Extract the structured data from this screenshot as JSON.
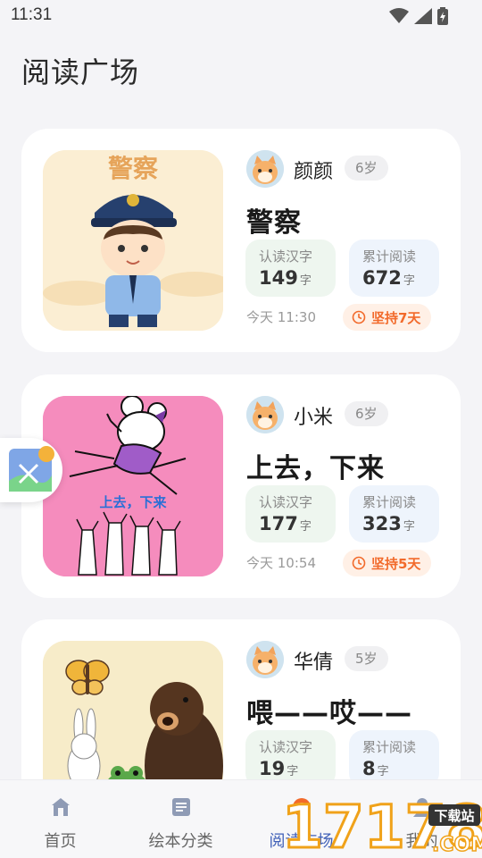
{
  "status_bar": {
    "time": "11:31"
  },
  "page_title": "阅读广场",
  "cards": [
    {
      "user_name": "颜颜",
      "age": "6岁",
      "book_title": "警察",
      "stat_words_label": "认读汉字",
      "stat_words_value": "149",
      "stat_words_unit": "字",
      "stat_read_label": "累计阅读",
      "stat_read_value": "672",
      "stat_read_unit": "字",
      "time": "今天 11:30",
      "streak": "坚持7天",
      "cover_text": "警察"
    },
    {
      "user_name": "小米",
      "age": "6岁",
      "book_title": "上去，下来",
      "stat_words_label": "认读汉字",
      "stat_words_value": "177",
      "stat_words_unit": "字",
      "stat_read_label": "累计阅读",
      "stat_read_value": "323",
      "stat_read_unit": "字",
      "time": "今天 10:54",
      "streak": "坚持5天",
      "cover_text": "上去，下来"
    },
    {
      "user_name": "华倩",
      "age": "5岁",
      "book_title": "喂——哎——",
      "stat_words_label": "认读汉字",
      "stat_words_value": "19",
      "stat_words_unit": "字",
      "stat_read_label": "累计阅读",
      "stat_read_value": "8",
      "stat_read_unit": "字"
    }
  ],
  "bottom_nav": {
    "items": [
      {
        "label": "首页",
        "icon": "home-icon"
      },
      {
        "label": "绘本分类",
        "icon": "book-icon"
      },
      {
        "label": "阅读广场",
        "icon": "plaza-icon"
      },
      {
        "label": "我的",
        "icon": "profile-icon"
      }
    ],
    "active_index": 2
  },
  "watermark": {
    "text": "17178",
    "sub": "下载站",
    "domain": ".COM"
  },
  "colors": {
    "accent": "#3f5fb7",
    "streak": "#f26a2b",
    "card_bg": "#ffffff",
    "page_bg": "#f4f4f7"
  }
}
